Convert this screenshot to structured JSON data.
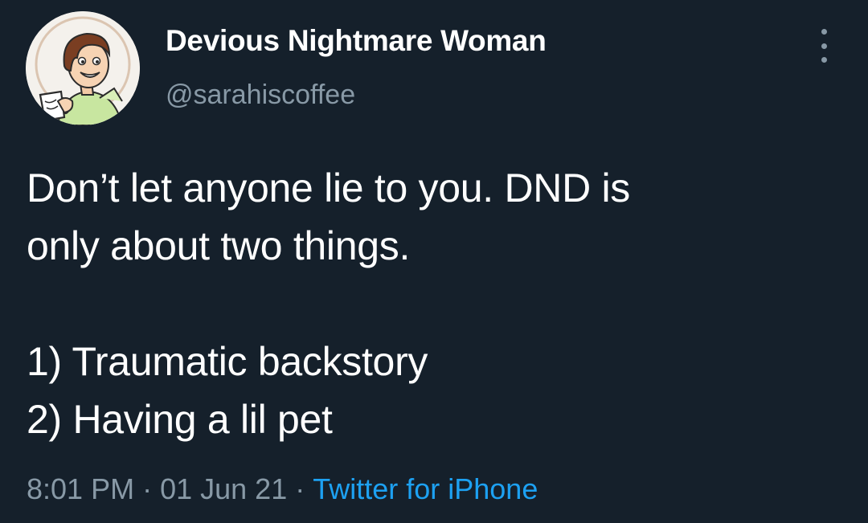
{
  "author": {
    "display_name": "Devious Nightmare Woman",
    "handle": "@sarahiscoffee",
    "avatar": "avatar-illustration-woman-with-coffee-mug"
  },
  "menu": {
    "icon": "more-vertical-icon"
  },
  "tweet": {
    "lines": [
      "Don’t let anyone lie to you. DND is",
      "only about two things.",
      "",
      "1) Traumatic backstory",
      "2) Having a lil pet"
    ]
  },
  "meta": {
    "time": "8:01 PM",
    "separator": "·",
    "date": "01 Jun 21",
    "source": "Twitter for iPhone"
  },
  "colors": {
    "background": "#15202b",
    "text": "#ffffff",
    "secondary_text": "#8899a6",
    "link": "#1da1f2"
  }
}
